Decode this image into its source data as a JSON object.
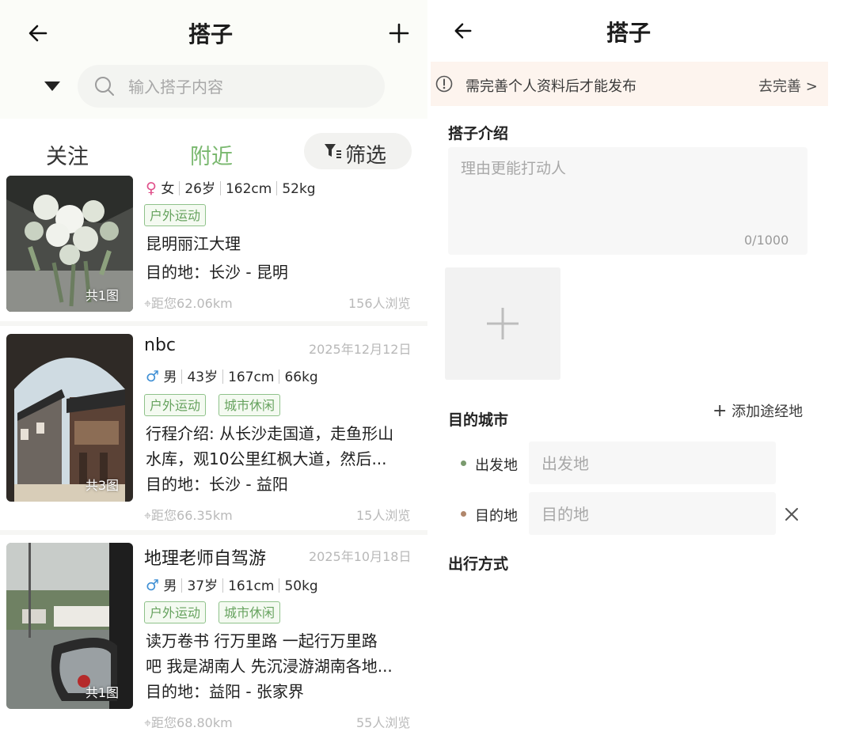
{
  "left": {
    "header": {
      "title": "搭子"
    },
    "search": {
      "placeholder": "输入搭子内容"
    },
    "tabs": [
      {
        "label": "关注",
        "active": false
      },
      {
        "label": "附近",
        "active": true
      }
    ],
    "filter_label": "筛选",
    "colors": {
      "accent_green": "#7ab86f",
      "female": "#e04f8a",
      "male": "#3f8fd4",
      "tag_border": "#8fc28a"
    },
    "posts": [
      {
        "gender_symbol": "♀",
        "gender": "女",
        "age": "26岁",
        "height": "162cm",
        "weight": "52kg",
        "tags": [
          "户外运动"
        ],
        "body": [
          "昆明丽江大理"
        ],
        "destination": "目的地：长沙 - 昆明",
        "image_count": "共1图",
        "distance": "距您62.06km",
        "views": "156人浏览"
      },
      {
        "name": "nbc",
        "date": "2025年12月12日",
        "gender_symbol": "♂",
        "gender": "男",
        "age": "43岁",
        "height": "167cm",
        "weight": "66kg",
        "tags": [
          "户外运动",
          "城市休闲"
        ],
        "body": [
          "行程介绍: 从长沙走国道，走鱼形山",
          "水库，观10公里红枫大道，然后..."
        ],
        "destination": "目的地：长沙 - 益阳",
        "image_count": "共3图",
        "distance": "距您66.35km",
        "views": "15人浏览"
      },
      {
        "name": "地理老师自驾游",
        "date": "2025年10月18日",
        "gender_symbol": "♂",
        "gender": "男",
        "age": "37岁",
        "height": "161cm",
        "weight": "50kg",
        "tags": [
          "户外运动",
          "城市休闲"
        ],
        "body": [
          "读万卷书 行万里路 一起行万里路",
          "吧 我是湖南人 先沉浸游湖南各地..."
        ],
        "destination": "目的地：益阳 - 张家界",
        "image_count": "共1图",
        "distance": "距您68.80km",
        "views": "55人浏览"
      }
    ]
  },
  "right": {
    "header": {
      "title": "搭子"
    },
    "notice": {
      "text": "需完善个人资料后才能发布",
      "action": "去完善 >"
    },
    "intro": {
      "label": "搭子介绍",
      "placeholder": "理由更能打动人",
      "counter": "0/1000"
    },
    "destination_city": {
      "label": "目的城市",
      "add_stop": "添加途经地",
      "departure_label": "出发地",
      "departure_placeholder": "出发地",
      "arrival_label": "目的地",
      "arrival_placeholder": "目的地"
    },
    "travel_mode": {
      "label": "出行方式"
    }
  }
}
